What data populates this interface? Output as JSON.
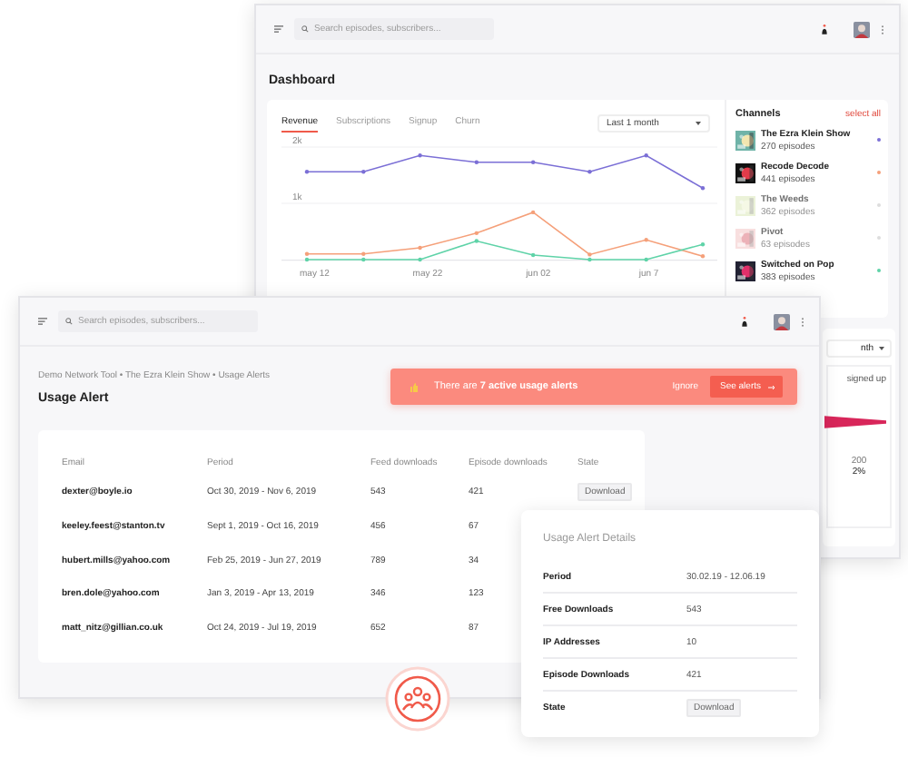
{
  "dashboard": {
    "search": {
      "placeholder": "Search episodes, subscribers..."
    },
    "title": "Dashboard",
    "tabs": [
      {
        "label": "Revenue",
        "selected": true
      },
      {
        "label": "Subscriptions",
        "selected": false
      },
      {
        "label": "Signup",
        "selected": false
      },
      {
        "label": "Churn",
        "selected": false
      }
    ],
    "range": "Last 1 month",
    "chart_data": {
      "type": "line",
      "categories": [
        "may 12",
        null,
        "may 22",
        null,
        "jun 02",
        null,
        "jun 7",
        null
      ],
      "yticks": [
        {
          "value": 1,
          "label": "1k"
        },
        {
          "value": 2,
          "label": "2k"
        }
      ],
      "ylim": [
        0,
        2
      ],
      "series": [
        {
          "color": "#7b6fd6",
          "values": [
            1.56,
            1.56,
            1.85,
            1.73,
            1.73,
            1.56,
            1.85,
            1.27
          ]
        },
        {
          "color": "#f5a07a",
          "values": [
            0.1,
            0.1,
            0.21,
            0.47,
            0.84,
            0.09,
            0.35,
            0.06
          ]
        },
        {
          "color": "#5fd3a8",
          "values": [
            0,
            0,
            0,
            0.33,
            0.08,
            0,
            0,
            0.27
          ]
        }
      ]
    },
    "channels": {
      "title": "Channels",
      "action": "select all",
      "items": [
        {
          "name": "The Ezra Klein Show",
          "episodes": "270 episodes",
          "color": "#7b6fd6",
          "enabled": true
        },
        {
          "name": "Recode Decode",
          "episodes": "441 episodes",
          "color": "#f5a07a",
          "enabled": true
        },
        {
          "name": "The Weeds",
          "episodes": "362 episodes",
          "color": "#dddddd",
          "enabled": false
        },
        {
          "name": "Pivot",
          "episodes": "63 episodes",
          "color": "#dddddd",
          "enabled": false
        },
        {
          "name": "Switched on Pop",
          "episodes": "383 episodes",
          "color": "#5fd3a8",
          "enabled": true
        }
      ]
    },
    "side_card": {
      "range": "nth",
      "label": "signed up",
      "value": "200",
      "percent": "2%"
    }
  },
  "usage": {
    "search": {
      "placeholder": "Search episodes, subscribers..."
    },
    "breadcrumb": "Demo Network Tool • The Ezra Klein Show • Usage Alerts",
    "title": "Usage Alert",
    "alert": {
      "text": "There are **7 active usage alerts**",
      "ignore": "Ignore",
      "action": "See alerts"
    },
    "table": {
      "columns": [
        "Email",
        "Period",
        "Feed downloads",
        "Episode downloads",
        "State"
      ],
      "rows": [
        {
          "email": "dexter@boyle.io",
          "period": "Oct 30, 2019 - Nov 6, 2019",
          "feed": "543",
          "episode": "421",
          "state": "Download"
        },
        {
          "email": "keeley.feest@stanton.tv",
          "period": "Sept 1, 2019 - Oct 16, 2019",
          "feed": "456",
          "episode": "67"
        },
        {
          "email": "hubert.mills@yahoo.com",
          "period": "Feb 25, 2019 - Jun 27, 2019",
          "feed": "789",
          "episode": "34"
        },
        {
          "email": "bren.dole@yahoo.com",
          "period": "Jan 3, 2019 - Apr 13, 2019",
          "feed": "346",
          "episode": "123"
        },
        {
          "email": "matt_nitz@gillian.co.uk",
          "period": "Oct 24, 2019 - Jul 19, 2019",
          "feed": "652",
          "episode": "87"
        }
      ]
    }
  },
  "details": {
    "title": "Usage Alert Details",
    "rows": [
      {
        "kind": "text",
        "label": "Period",
        "value": "30.02.19 - 12.06.19"
      },
      {
        "kind": "text",
        "label": "Free Downloads",
        "value": "543"
      },
      {
        "kind": "text",
        "label": "IP Addresses",
        "value": "10"
      },
      {
        "kind": "text",
        "label": "Episode Downloads",
        "value": "421"
      },
      {
        "kind": "badge",
        "label": "State",
        "value": "Download"
      }
    ]
  }
}
